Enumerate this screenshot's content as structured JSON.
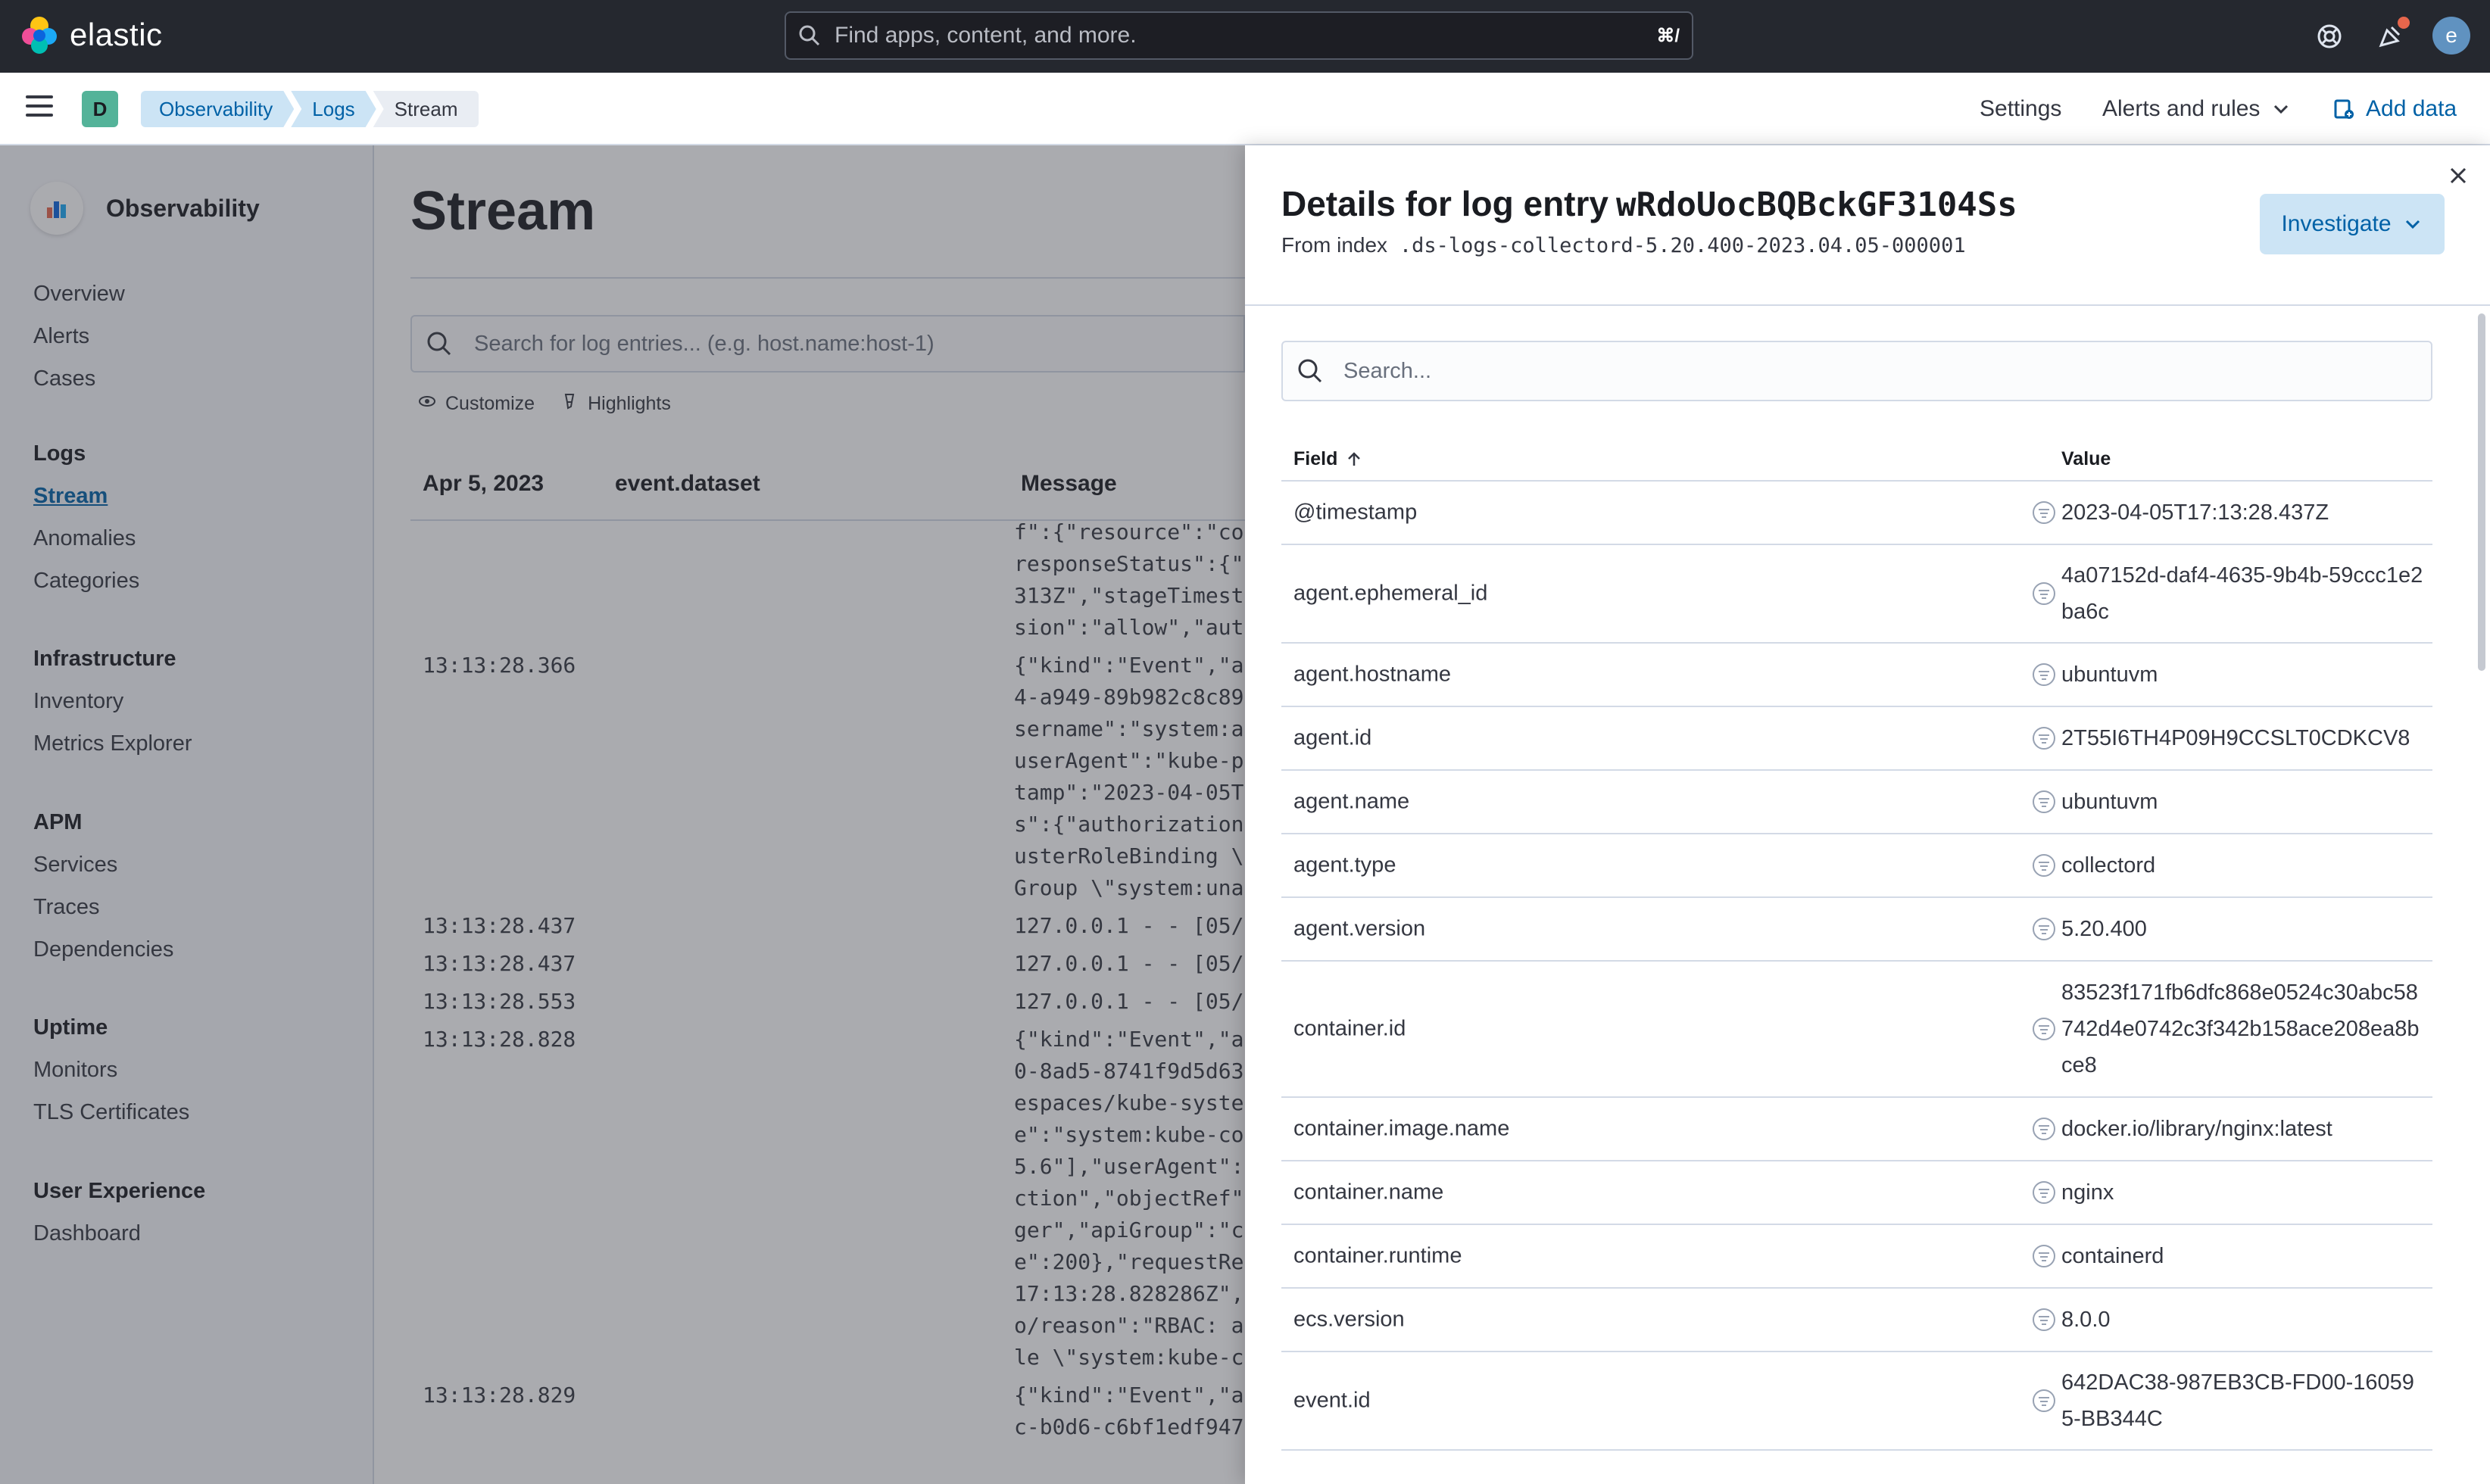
{
  "header": {
    "brand": "elastic",
    "search_placeholder": "Find apps, content, and more.",
    "search_shortcut": "⌘/",
    "user_initial": "e"
  },
  "subbar": {
    "space_initial": "D",
    "breadcrumbs": [
      "Observability",
      "Logs",
      "Stream"
    ],
    "settings_label": "Settings",
    "alerts_label": "Alerts and rules",
    "add_data_label": "Add data"
  },
  "sidebar": {
    "title": "Observability",
    "top_items": [
      "Overview",
      "Alerts",
      "Cases"
    ],
    "sections": [
      {
        "title": "Logs",
        "items": [
          "Stream",
          "Anomalies",
          "Categories"
        ]
      },
      {
        "title": "Infrastructure",
        "items": [
          "Inventory",
          "Metrics Explorer"
        ]
      },
      {
        "title": "APM",
        "items": [
          "Services",
          "Traces",
          "Dependencies"
        ]
      },
      {
        "title": "Uptime",
        "items": [
          "Monitors",
          "TLS Certificates"
        ]
      },
      {
        "title": "User Experience",
        "items": [
          "Dashboard"
        ]
      }
    ],
    "active_item": "Stream"
  },
  "stream": {
    "title": "Stream",
    "search_placeholder": "Search for log entries... (e.g. host.name:host-1)",
    "customize_label": "Customize",
    "highlights_label": "Highlights",
    "columns": {
      "date": "Apr 5, 2023",
      "dataset": "event.dataset",
      "message": "Message"
    },
    "lines": [
      {
        "time": "",
        "message": [
          "f\":{\"resource\":\"co",
          "responseStatus\":{\"",
          "313Z\",\"stageTimest",
          "sion\":\"allow\",\"aut"
        ]
      },
      {
        "time": "13:13:28.366",
        "message": [
          "{\"kind\":\"Event\",\"a",
          "4-a949-89b982c8c89",
          "sername\":\"system:a",
          "userAgent\":\"kube-p",
          "tamp\":\"2023-04-05T",
          "s\":{\"authorization",
          "usterRoleBinding \\",
          "Group \\\"system:una"
        ]
      },
      {
        "time": "13:13:28.437",
        "message": [
          "127.0.0.1 - - [05/"
        ]
      },
      {
        "time": "13:13:28.437",
        "message": [
          "127.0.0.1 - - [05/"
        ]
      },
      {
        "time": "13:13:28.553",
        "message": [
          "127.0.0.1 - - [05/"
        ]
      },
      {
        "time": "13:13:28.828",
        "message": [
          "{\"kind\":\"Event\",\"a",
          "0-8ad5-8741f9d5d63",
          "espaces/kube-syste",
          "e\":\"system:kube-co",
          "5.6\"],\"userAgent\":",
          "ction\",\"objectRef\"",
          "ger\",\"apiGroup\":\"c",
          "e\":200},\"requestRe",
          "17:13:28.828286Z\",",
          "o/reason\":\"RBAC: a",
          "le \\\"system:kube-c"
        ]
      },
      {
        "time": "13:13:28.829",
        "message": [
          "{\"kind\":\"Event\",\"a",
          "c-b0d6-c6bf1edf947"
        ]
      }
    ]
  },
  "flyout": {
    "title_prefix": "Details for log entry",
    "entry_id": "wRdoUocBQBckGF3104Ss",
    "index_prefix": "From index",
    "index_name": ".ds-logs-collectord-5.20.400-2023.04.05-000001",
    "investigate_label": "Investigate",
    "search_placeholder": "Search...",
    "field_header": "Field",
    "value_header": "Value",
    "rows": [
      {
        "field": "@timestamp",
        "value": "2023-04-05T17:13:28.437Z"
      },
      {
        "field": "agent.ephemeral_id",
        "value": "4a07152d-daf4-4635-9b4b-59ccc1e2ba6c"
      },
      {
        "field": "agent.hostname",
        "value": "ubuntuvm"
      },
      {
        "field": "agent.id",
        "value": "2T55I6TH4P09H9CCSLT0CDKCV8"
      },
      {
        "field": "agent.name",
        "value": "ubuntuvm"
      },
      {
        "field": "agent.type",
        "value": "collectord"
      },
      {
        "field": "agent.version",
        "value": "5.20.400"
      },
      {
        "field": "container.id",
        "value": "83523f171fb6dfc868e0524c30abc58742d4e0742c3f342b158ace208ea8bce8"
      },
      {
        "field": "container.image.name",
        "value": "docker.io/library/nginx:latest"
      },
      {
        "field": "container.name",
        "value": "nginx"
      },
      {
        "field": "container.runtime",
        "value": "containerd"
      },
      {
        "field": "ecs.version",
        "value": "8.0.0"
      },
      {
        "field": "event.id",
        "value": "642DAC38-987EB3CB-FD00-160595-BB344C"
      }
    ]
  }
}
